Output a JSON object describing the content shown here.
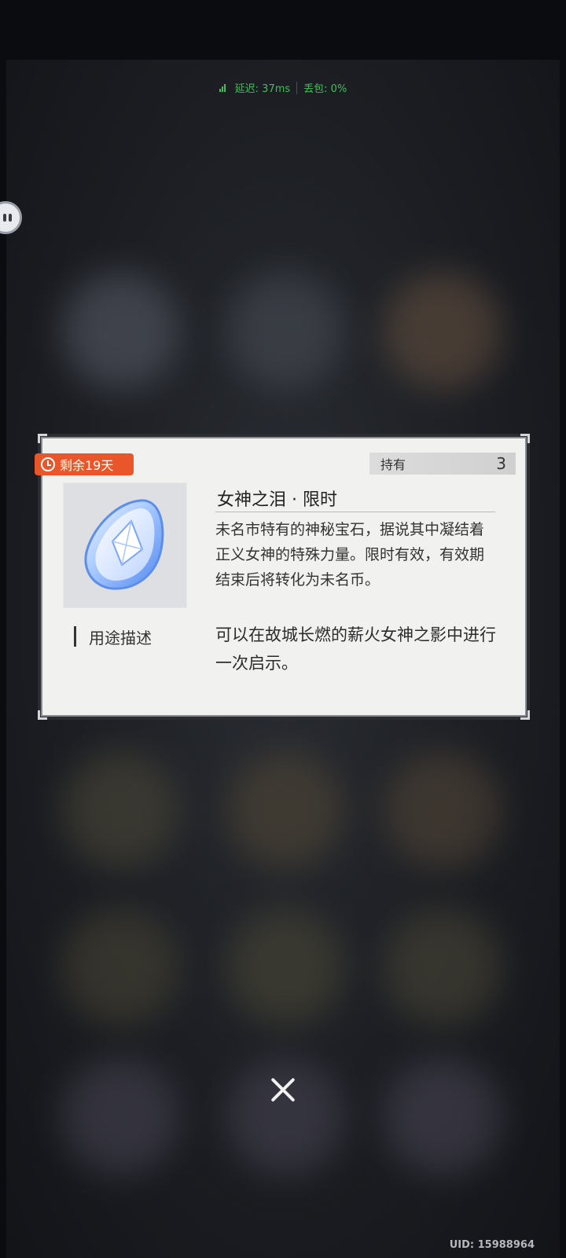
{
  "status_bar": {
    "latency": "延迟: 37ms",
    "packet_loss": "丢包: 0%"
  },
  "item_card": {
    "time_remaining": "剩余19天",
    "owned_label": "持有",
    "owned_count": "3",
    "title": "女神之泪 · 限时",
    "description": "未名市特有的神秘宝石，据说其中凝结着正义女神的特殊力量。限时有效，有效期结束后将转化为未名币。",
    "usage_label": "用途描述",
    "usage_text": "可以在故城长燃的薪火女神之影中进行一次启示。",
    "accent_color": "#e8562a"
  },
  "footer": {
    "uid": "UID: 15988964"
  },
  "icons": {
    "close": "close-icon",
    "clock": "clock-icon",
    "signal": "signal-icon",
    "float": "floating-assistant-icon",
    "item": "gem-icon"
  }
}
